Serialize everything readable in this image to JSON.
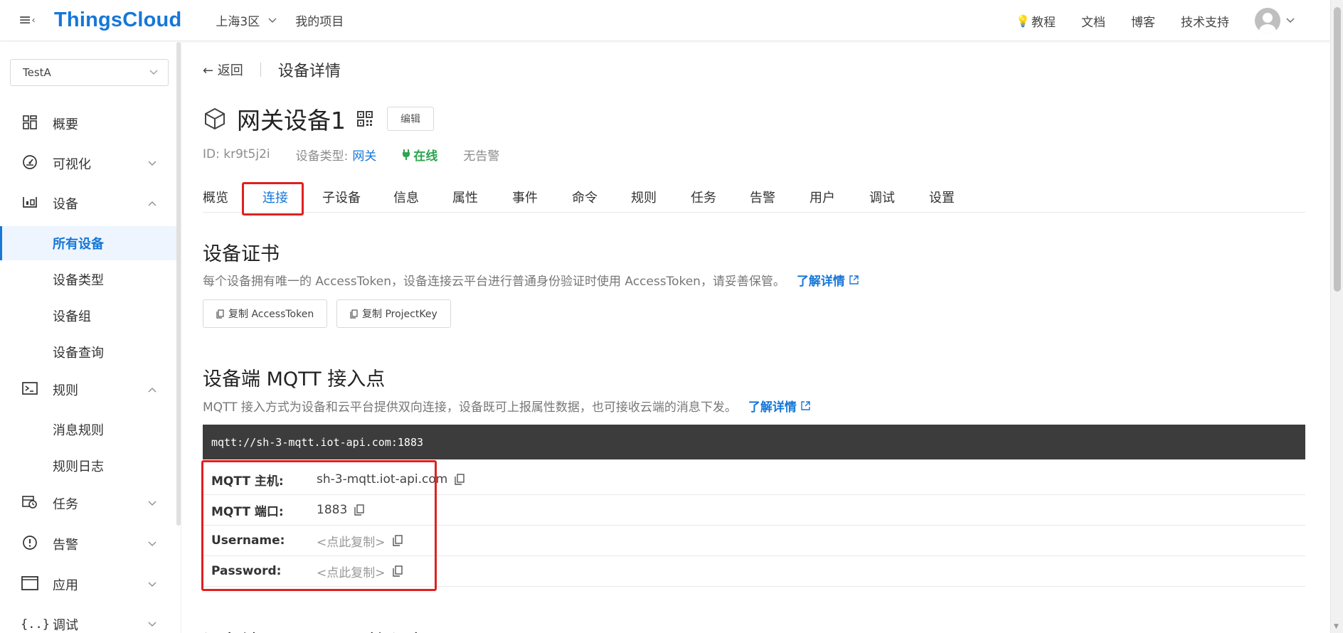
{
  "header": {
    "logo": "ThingsCloud",
    "region": "上海3区",
    "project": "我的项目",
    "links": [
      "教程",
      "文档",
      "博客",
      "技术支持"
    ]
  },
  "sidebar": {
    "project_select": "TestA",
    "items": [
      {
        "label": "概要",
        "icon": "dashboard-icon"
      },
      {
        "label": "可视化",
        "icon": "gauge-icon"
      },
      {
        "label": "设备",
        "icon": "device-icon"
      },
      {
        "label": "所有设备",
        "sub": true,
        "active": true
      },
      {
        "label": "设备类型",
        "sub": true
      },
      {
        "label": "设备组",
        "sub": true
      },
      {
        "label": "设备查询",
        "sub": true
      },
      {
        "label": "规则",
        "icon": "terminal-icon"
      },
      {
        "label": "消息规则",
        "sub": true
      },
      {
        "label": "规则日志",
        "sub": true
      },
      {
        "label": "任务",
        "icon": "task-clock-icon"
      },
      {
        "label": "告警",
        "icon": "alert-icon"
      },
      {
        "label": "应用",
        "icon": "app-window-icon"
      },
      {
        "label": "调试",
        "icon": "debug-braces-icon"
      }
    ]
  },
  "breadcrumb": {
    "back": "← 返回",
    "title": "设备详情"
  },
  "device": {
    "name": "网关设备1",
    "edit_label": "编辑",
    "id_text": "ID: kr9t5j2i",
    "type_label": "设备类型:",
    "type_value": "网关",
    "status": "在线",
    "alarm": "无告警"
  },
  "tabs": [
    "概览",
    "连接",
    "子设备",
    "信息",
    "属性",
    "事件",
    "命令",
    "规则",
    "任务",
    "告警",
    "用户",
    "调试",
    "设置"
  ],
  "active_tab": "连接",
  "cert_section": {
    "title": "设备证书",
    "desc": "每个设备拥有唯一的 AccessToken，设备连接云平台进行普通身份验证时使用 AccessToken，请妥善保管。",
    "learn_more": "了解详情",
    "copy_token": "复制 AccessToken",
    "copy_project": "复制 ProjectKey"
  },
  "mqtt_section": {
    "title": "设备端 MQTT 接入点",
    "desc": "MQTT 接入方式为设备和云平台提供双向连接，设备既可上报属性数据，也可接收云端的消息下发。",
    "learn_more": "了解详情",
    "endpoint": "mqtt://sh-3-mqtt.iot-api.com:1883",
    "rows": [
      {
        "label": "MQTT 主机:",
        "value": "sh-3-mqtt.iot-api.com"
      },
      {
        "label": "MQTT 端口:",
        "value": "1883"
      },
      {
        "label": "Username:",
        "value": "<点此复制>"
      },
      {
        "label": "Password:",
        "value": "<点此复制>"
      }
    ]
  },
  "tls_section": {
    "title": "设备端 MQTT  TLS 接入点"
  },
  "colors": {
    "brand": "#1677d8",
    "online": "#2ea44f",
    "highlight": "#e02020",
    "endpoint_bg": "#3c3c3c"
  }
}
